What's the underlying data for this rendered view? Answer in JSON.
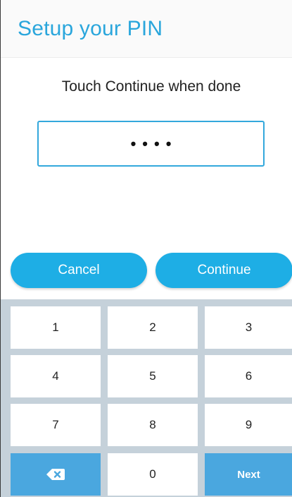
{
  "header": {
    "title": "Setup your PIN"
  },
  "instruction": "Touch Continue when done",
  "pin": {
    "masked_value": "••••"
  },
  "actions": {
    "cancel_label": "Cancel",
    "continue_label": "Continue"
  },
  "keypad": {
    "keys": [
      "1",
      "2",
      "3",
      "4",
      "5",
      "6",
      "7",
      "8",
      "9"
    ],
    "zero": "0",
    "next_label": "Next",
    "backspace_icon": "backspace-icon"
  },
  "colors": {
    "accent": "#1eaee5",
    "title": "#2aa6dc",
    "keypad_bg": "#c5d1da",
    "special_key": "#4aa7df"
  }
}
